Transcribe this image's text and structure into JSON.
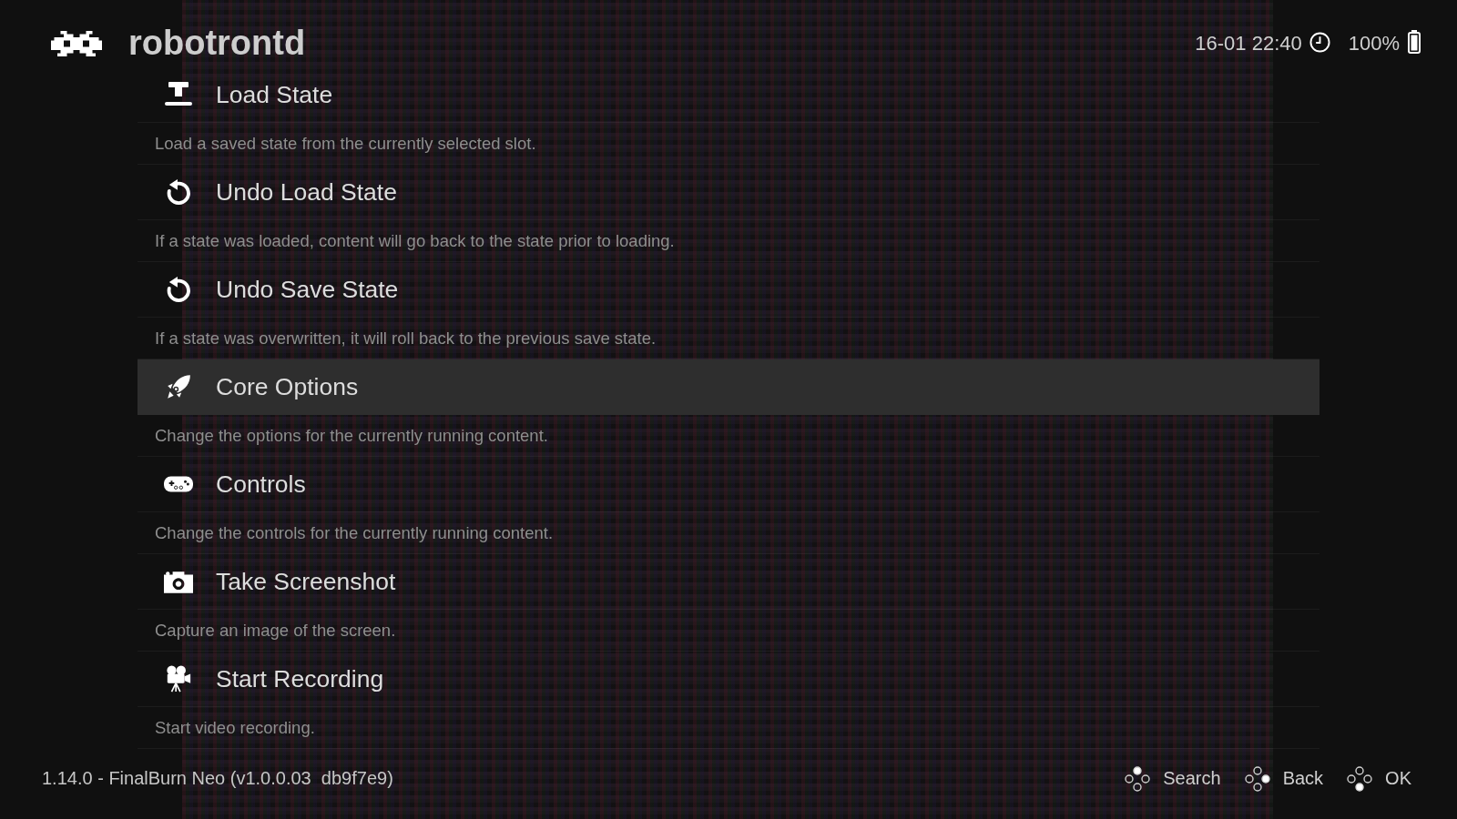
{
  "header": {
    "title": "robotrontd",
    "datetime": "16-01 22:40",
    "battery": "100%"
  },
  "menu": {
    "items": [
      {
        "kind": "load",
        "title": "Load State",
        "description": "Load a saved state from the currently selected slot.",
        "selected": false
      },
      {
        "kind": "undo",
        "title": "Undo Load State",
        "description": "If a state was loaded, content will go back to the state prior to loading.",
        "selected": false
      },
      {
        "kind": "undo",
        "title": "Undo Save State",
        "description": "If a state was overwritten, it will roll back to the previous save state.",
        "selected": false
      },
      {
        "kind": "options",
        "title": "Core Options",
        "description": "Change the options for the currently running content.",
        "selected": true
      },
      {
        "kind": "controls",
        "title": "Controls",
        "description": "Change the controls for the currently running content.",
        "selected": false
      },
      {
        "kind": "screenshot",
        "title": "Take Screenshot",
        "description": "Capture an image of the screen.",
        "selected": false
      },
      {
        "kind": "recording",
        "title": "Start Recording",
        "description": "Start video recording.",
        "selected": false
      }
    ]
  },
  "footer": {
    "version": "1.14.0 - FinalBurn Neo (v1.0.0.03  db9f7e9)",
    "hints": [
      {
        "label": "Search",
        "kind": "up"
      },
      {
        "label": "Back",
        "kind": "right"
      },
      {
        "label": "OK",
        "kind": "down"
      }
    ]
  }
}
